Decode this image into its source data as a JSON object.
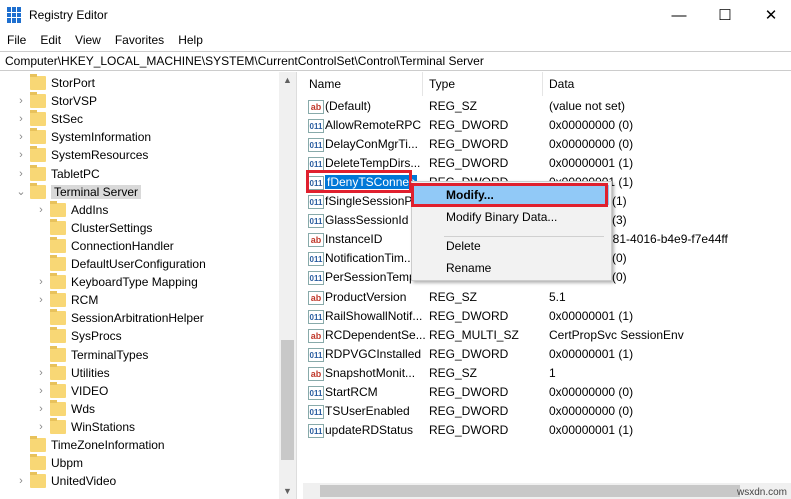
{
  "window": {
    "title": "Registry Editor",
    "minimize": "—",
    "maximize": "☐",
    "close": "✕"
  },
  "menu": [
    "File",
    "Edit",
    "View",
    "Favorites",
    "Help"
  ],
  "address": "Computer\\HKEY_LOCAL_MACHINE\\SYSTEM\\CurrentControlSet\\Control\\Terminal Server",
  "tree": [
    {
      "label": "StorPort",
      "level": 0,
      "chevron": ""
    },
    {
      "label": "StorVSP",
      "level": 0,
      "chevron": "›"
    },
    {
      "label": "StSec",
      "level": 0,
      "chevron": "›"
    },
    {
      "label": "SystemInformation",
      "level": 0,
      "chevron": "›"
    },
    {
      "label": "SystemResources",
      "level": 0,
      "chevron": "›"
    },
    {
      "label": "TabletPC",
      "level": 0,
      "chevron": "›"
    },
    {
      "label": "Terminal Server",
      "level": 0,
      "chevron": "⌄",
      "selected": true
    },
    {
      "label": "AddIns",
      "level": 1,
      "chevron": "›"
    },
    {
      "label": "ClusterSettings",
      "level": 1,
      "chevron": ""
    },
    {
      "label": "ConnectionHandler",
      "level": 1,
      "chevron": ""
    },
    {
      "label": "DefaultUserConfiguration",
      "level": 1,
      "chevron": ""
    },
    {
      "label": "KeyboardType Mapping",
      "level": 1,
      "chevron": "›"
    },
    {
      "label": "RCM",
      "level": 1,
      "chevron": "›"
    },
    {
      "label": "SessionArbitrationHelper",
      "level": 1,
      "chevron": ""
    },
    {
      "label": "SysProcs",
      "level": 1,
      "chevron": ""
    },
    {
      "label": "TerminalTypes",
      "level": 1,
      "chevron": ""
    },
    {
      "label": "Utilities",
      "level": 1,
      "chevron": "›"
    },
    {
      "label": "VIDEO",
      "level": 1,
      "chevron": "›"
    },
    {
      "label": "Wds",
      "level": 1,
      "chevron": "›"
    },
    {
      "label": "WinStations",
      "level": 1,
      "chevron": "›"
    },
    {
      "label": "TimeZoneInformation",
      "level": 0,
      "chevron": ""
    },
    {
      "label": "Ubpm",
      "level": 0,
      "chevron": ""
    },
    {
      "label": "UnitedVideo",
      "level": 0,
      "chevron": "›"
    }
  ],
  "columns": [
    "Name",
    "Type",
    "Data"
  ],
  "values": [
    {
      "name": "(Default)",
      "type": "REG_SZ",
      "data": "(value not set)",
      "icon": "sz"
    },
    {
      "name": "AllowRemoteRPC",
      "type": "REG_DWORD",
      "data": "0x00000000 (0)",
      "icon": "dw"
    },
    {
      "name": "DelayConMgrTi...",
      "type": "REG_DWORD",
      "data": "0x00000000 (0)",
      "icon": "dw"
    },
    {
      "name": "DeleteTempDirs...",
      "type": "REG_DWORD",
      "data": "0x00000001 (1)",
      "icon": "dw"
    },
    {
      "name": "fDenyTSConnec",
      "type": "REG_DWORD",
      "data": "0x00000001 (1)",
      "icon": "dw",
      "selected": true
    },
    {
      "name": "fSingleSessionP",
      "type": "",
      "data": "(1)",
      "icon": "dw"
    },
    {
      "name": "GlassSessionId",
      "type": "",
      "data": "(3)",
      "icon": "dw"
    },
    {
      "name": "InstanceID",
      "type": "",
      "data": "d81-4016-b4e9-f7e44ff",
      "icon": "sz"
    },
    {
      "name": "NotificationTim...",
      "type": "",
      "data": "(0)",
      "icon": "dw"
    },
    {
      "name": "PerSessionTemp",
      "type": "",
      "data": "(0)",
      "icon": "dw"
    },
    {
      "name": "ProductVersion",
      "type": "REG_SZ",
      "data": "5.1",
      "icon": "sz"
    },
    {
      "name": "RailShowallNotif...",
      "type": "REG_DWORD",
      "data": "0x00000001 (1)",
      "icon": "dw"
    },
    {
      "name": "RCDependentSe...",
      "type": "REG_MULTI_SZ",
      "data": "CertPropSvc SessionEnv",
      "icon": "sz"
    },
    {
      "name": "RDPVGCInstalled",
      "type": "REG_DWORD",
      "data": "0x00000001 (1)",
      "icon": "dw"
    },
    {
      "name": "SnapshotMonit...",
      "type": "REG_SZ",
      "data": "1",
      "icon": "sz"
    },
    {
      "name": "StartRCM",
      "type": "REG_DWORD",
      "data": "0x00000000 (0)",
      "icon": "dw"
    },
    {
      "name": "TSUserEnabled",
      "type": "REG_DWORD",
      "data": "0x00000000 (0)",
      "icon": "dw"
    },
    {
      "name": "updateRDStatus",
      "type": "REG_DWORD",
      "data": "0x00000001 (1)",
      "icon": "dw"
    }
  ],
  "context_menu": {
    "modify": "Modify...",
    "modify_binary": "Modify Binary Data...",
    "delete": "Delete",
    "rename": "Rename"
  },
  "icons": {
    "sz": "ab",
    "dw": "011"
  },
  "watermark": "wsxdn.com"
}
